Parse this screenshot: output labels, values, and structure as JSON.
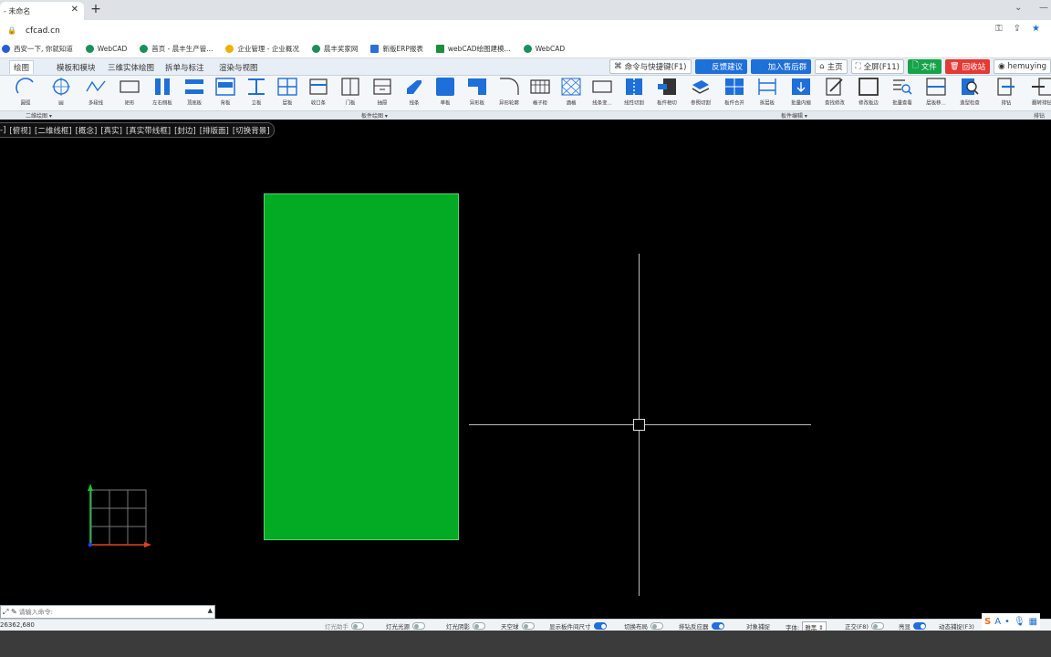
{
  "browser": {
    "tab_title": "- 未命名",
    "url": "cfcad.cn",
    "bookmarks": [
      "西安一下, 你就知道",
      "WebCAD",
      "首页 - 晨丰生产管...",
      "企业管理 - 企业概况",
      "晨丰奖家网",
      "新版ERP报表",
      "webCAD绘图建模...",
      "WebCAD"
    ]
  },
  "ribbon": {
    "tabs": [
      "绘图",
      "模板和模块",
      "三维实体绘图",
      "拆单与标注",
      "渲染与视图"
    ],
    "top_buttons": {
      "command": "命令与快捷键(F1)",
      "feedback": "反馈建议",
      "join": "加入售后群",
      "home": "主页",
      "fullscreen": "全屏(F11)",
      "file": "文件",
      "recycle": "回收站",
      "user": "hemuying"
    },
    "tools": [
      "圆弧",
      "圆",
      "多段线",
      "矩形",
      "左右侧板",
      "顶底板",
      "背板",
      "立板",
      "层板",
      "收口条",
      "门板",
      "抽屉",
      "线条",
      "单板",
      "异形板",
      "异形轮廓",
      "格子柜",
      "酒格",
      "线条变...",
      "线性切割",
      "板件相切",
      "参照切割",
      "板件合并",
      "拆层板",
      "批量内缩",
      "查找修改",
      "修改板边",
      "批量查看",
      "层板移...",
      "造型检查",
      "排钻",
      "翻转排钻"
    ],
    "groups": [
      "二维绘图",
      "板件绘图",
      "板件编辑",
      "排钻"
    ]
  },
  "viewbar": [
    "-]",
    "[俯视]",
    "[二维线框]",
    "[概念]",
    "[真实]",
    "[真实带线框]",
    "[封边]",
    "[排版面]",
    "[切换背景]"
  ],
  "cmd": {
    "placeholder": "请输入命令:",
    "coords": "26362,680"
  },
  "status": {
    "items": [
      "灯光助手",
      "灯光光源",
      "灯光阴影",
      "天空球",
      "显示板件间尺寸",
      "切换布局",
      "排钻反应器",
      "对象捕捉",
      "字体:",
      "正交(F8)",
      "亮显",
      "动态捕捉(F3)"
    ],
    "font_value": "雅黑"
  },
  "colors": {
    "panel_green": "#03aa24",
    "accent_blue": "#1e6fd9",
    "canvas_bg": "#000000"
  }
}
